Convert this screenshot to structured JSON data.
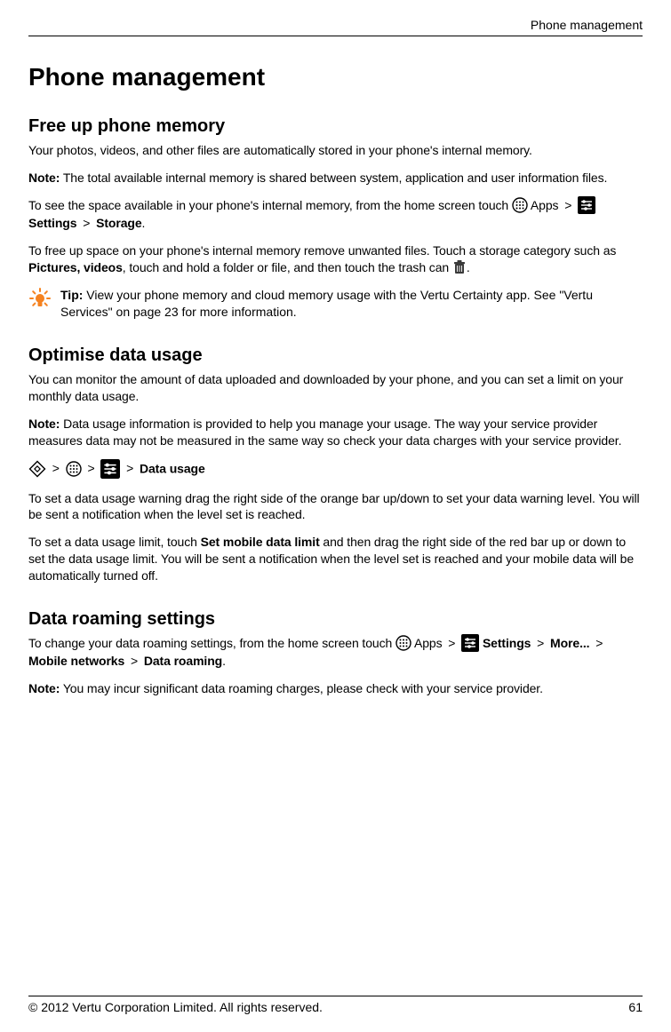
{
  "header": {
    "label": "Phone management"
  },
  "title": "Phone management",
  "s1": {
    "heading": "Free up phone memory",
    "p1": "Your photos, videos, and other files are automatically stored in your phone's internal memory.",
    "note_label": "Note:",
    "note_text": " The total available internal memory is shared between system, application and user information files.",
    "p3_a": "To see the space available in your phone's internal memory, from the home screen touch ",
    "p3_apps": " Apps",
    "p3_b": "Settings",
    "p3_c": "Storage",
    "gt": " > ",
    "period": ".",
    "p4_a": "To free up space on your phone's internal memory remove unwanted files. Touch a storage category such as ",
    "p4_b": "Pictures, videos",
    "p4_c": ", touch and hold a folder or file, and then touch the trash can ",
    "tip_label": "Tip:",
    "tip_text": " View your phone memory and cloud memory usage with the Vertu Certainty app. See \"Vertu Services\" on page 23 for more information."
  },
  "s2": {
    "heading": "Optimise data usage",
    "p1": "You can monitor the amount of data uploaded and downloaded by your phone, and you can set a limit on your monthly data usage.",
    "note_label": "Note:",
    "note_text": " Data usage information is provided to help you manage your usage. The way your service provider measures data may not be measured in the same way so check your data charges with your service provider.",
    "path_label": "Data usage",
    "gt": " > ",
    "p4": "To set a data usage warning drag the right side of the orange bar up/down to set your data warning level. You will be sent a notification when the level set is reached.",
    "p5_a": "To set a data usage limit, touch ",
    "p5_b": "Set mobile data limit",
    "p5_c": " and then drag the right side of the red bar up or down to set the data usage limit. You will be sent a notification when the level set is reached and your mobile data will be automatically turned off."
  },
  "s3": {
    "heading": "Data roaming settings",
    "p1_a": "To change your data roaming settings, from the home screen touch ",
    "apps": " Apps",
    "settings": " Settings",
    "more": "More...",
    "mobile": "Mobile networks",
    "roaming": "Data roaming",
    "gt": " > ",
    "period": ".",
    "note_label": "Note:",
    "note_text": " You may incur significant data roaming charges, please check with your service provider."
  },
  "footer": {
    "copyright": "© 2012 Vertu Corporation Limited. All rights reserved.",
    "page": "61"
  }
}
